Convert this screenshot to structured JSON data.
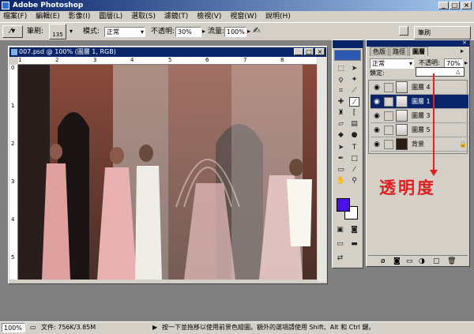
{
  "app": {
    "title": "Adobe Photoshop"
  },
  "menu": [
    "檔案(F)",
    "編輯(E)",
    "影像(I)",
    "圖層(L)",
    "選取(S)",
    "濾鏡(T)",
    "檢視(V)",
    "視窗(W)",
    "說明(H)"
  ],
  "options": {
    "brush_label": "筆刷:",
    "brush_size": "135",
    "mode_label": "模式:",
    "mode_value": "正常",
    "opacity_label": "不透明:",
    "opacity_value": "30%",
    "flow_label": "流量:",
    "flow_value": "100%",
    "right_tab": "筆刷"
  },
  "document": {
    "title": "007.psd @ 100% (圖層 1, RGB)",
    "ruler_h": [
      "1",
      "2",
      "3",
      "4",
      "5",
      "6",
      "7",
      "8"
    ],
    "ruler_v": [
      "0",
      "1",
      "2",
      "3",
      "4",
      "5"
    ]
  },
  "layers_panel": {
    "tabs": [
      "色版",
      "路徑",
      "圖層"
    ],
    "blend_mode": "正常",
    "opacity_label": "不透明:",
    "opacity_value": "70%",
    "lock_label": "鎖定:",
    "layers": [
      {
        "name": "圖層 4",
        "selected": false
      },
      {
        "name": "圖層 1",
        "selected": true
      },
      {
        "name": "圖層 3",
        "selected": false
      },
      {
        "name": "圖層 5",
        "selected": false
      },
      {
        "name": "背景",
        "selected": false
      }
    ]
  },
  "annotation": {
    "text": "透明度",
    "color": "#e02020"
  },
  "status": {
    "zoom": "100%",
    "doc_size": "文件: 756K/3.85M",
    "hint": "按一下並拖移以使用前景色繪圖。額外的選項請使用 Shift、Alt 和 Ctrl 鍵。"
  },
  "colors": {
    "foreground": "#4a10e8",
    "background": "#ffffff",
    "title_blue": "#0a246a"
  }
}
